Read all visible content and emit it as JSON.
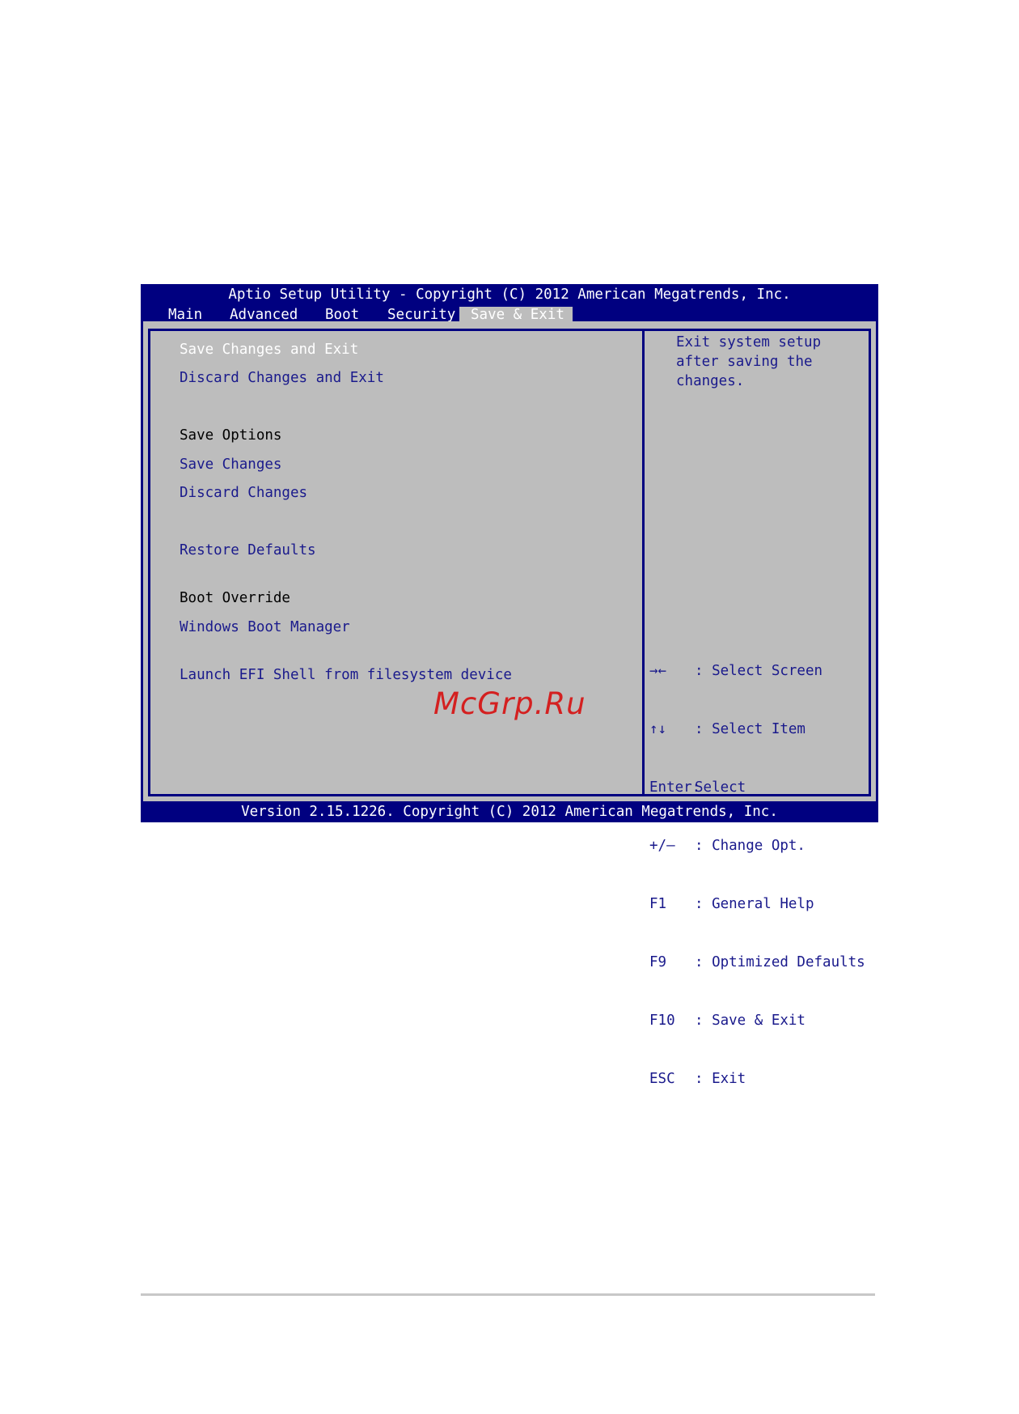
{
  "title": "Aptio Setup Utility - Copyright (C) 2012 American Megatrends, Inc.",
  "tabs": [
    {
      "label": "Main"
    },
    {
      "label": "Advanced"
    },
    {
      "label": "Boot"
    },
    {
      "label": "Security"
    },
    {
      "label": "Save & Exit"
    }
  ],
  "active_tab": "Save & Exit",
  "menu": {
    "save_changes_and_exit": "Save Changes and Exit",
    "discard_changes_and_exit": "Discard Changes and Exit",
    "save_options_header": "Save Options",
    "save_changes": "Save Changes",
    "discard_changes": "Discard Changes",
    "restore_defaults": "Restore Defaults",
    "boot_override_header": "Boot Override",
    "windows_boot_manager": "Windows Boot Manager",
    "launch_efi_shell": "Launch EFI Shell from filesystem device"
  },
  "help_text": "Exit system setup\nafter saving the\nchanges.",
  "keys": [
    {
      "key": "→←",
      "desc": ": Select Screen"
    },
    {
      "key": "↑↓",
      "desc": ": Select Item"
    },
    {
      "key": "Enter:",
      "desc": "Select"
    },
    {
      "key": "+/—",
      "desc": ": Change Opt."
    },
    {
      "key": "F1",
      "desc": ": General Help"
    },
    {
      "key": "F9",
      "desc": ": Optimized Defaults"
    },
    {
      "key": "F10",
      "desc": ": Save & Exit"
    },
    {
      "key": "ESC",
      "desc": ": Exit"
    }
  ],
  "footer": "Version 2.15.1226. Copyright (C) 2012 American Megatrends, Inc.",
  "watermark": "McGrp.Ru",
  "colors": {
    "bios_blue": "#000080",
    "panel_gray": "#bdbdbd",
    "item_blue": "#1a1a8c",
    "watermark_red": "#d42020"
  }
}
